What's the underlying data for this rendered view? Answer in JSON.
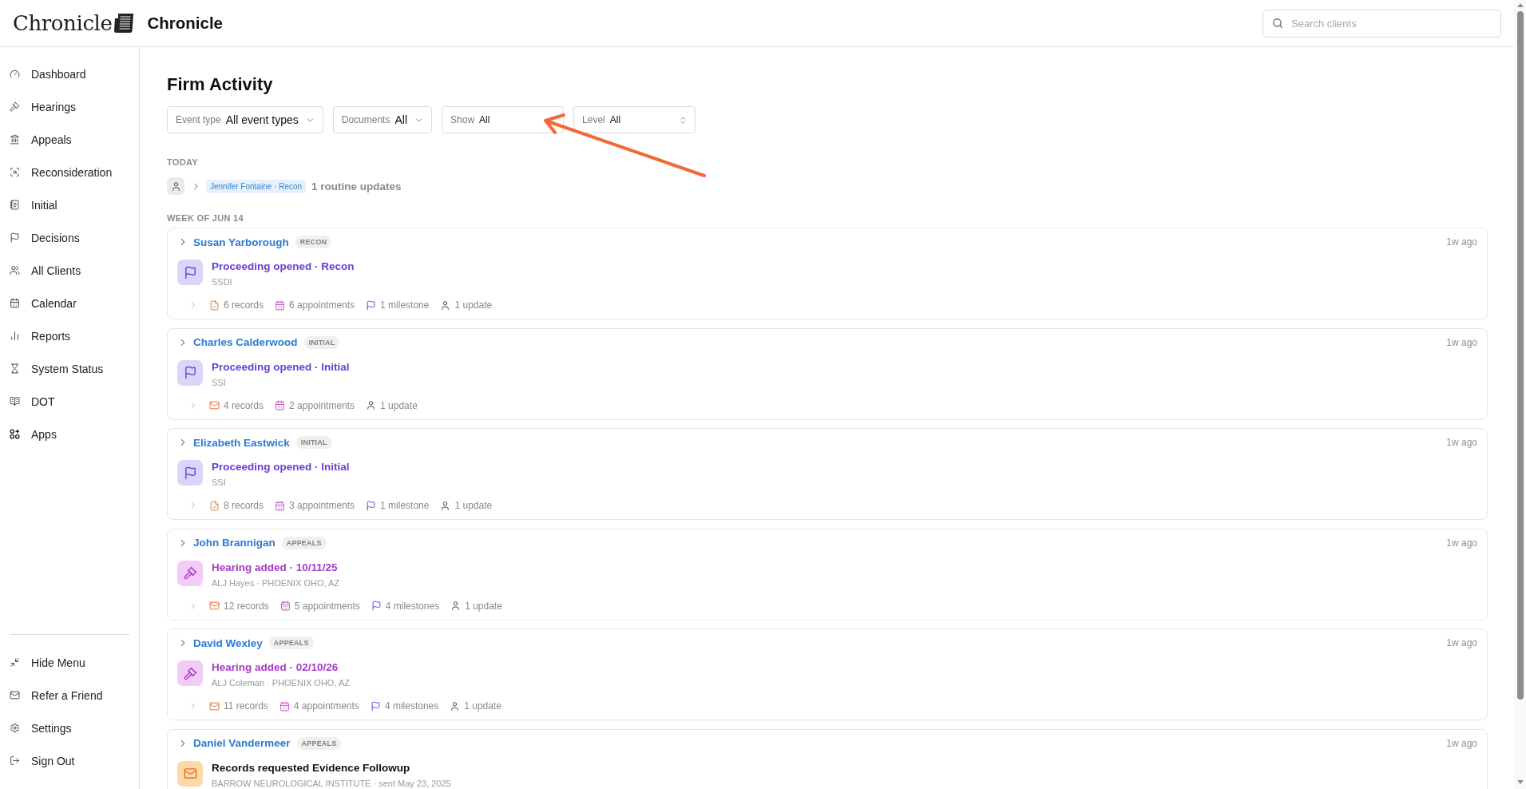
{
  "header": {
    "logo": "Chronicle",
    "title": "Chronicle",
    "search": {
      "placeholder": "Search clients"
    }
  },
  "sidebar": {
    "items": [
      {
        "label": "Dashboard",
        "selected": false
      },
      {
        "label": "Hearings",
        "selected": false
      },
      {
        "label": "Appeals",
        "selected": false
      },
      {
        "label": "Reconsideration",
        "selected": false
      },
      {
        "label": "Initial",
        "selected": false
      },
      {
        "label": "Decisions",
        "selected": false
      },
      {
        "label": "All Clients",
        "selected": false
      },
      {
        "label": "Calendar",
        "selected": false
      },
      {
        "label": "Reports",
        "selected": false
      },
      {
        "label": "System Status",
        "selected": false
      },
      {
        "label": "DOT",
        "selected": false
      },
      {
        "label": "Apps",
        "selected": false
      }
    ],
    "footer_items": [
      {
        "label": "Hide Menu"
      },
      {
        "label": "Refer a Friend"
      },
      {
        "label": "Settings"
      },
      {
        "label": "Sign Out"
      }
    ]
  },
  "page": {
    "title": "Firm Activity",
    "filters": [
      {
        "kind": "dropdown",
        "label": "Event type",
        "value": "All event types"
      },
      {
        "kind": "dropdown",
        "label": "Documents",
        "value": "All"
      },
      {
        "kind": "select",
        "label": "Show",
        "value": "All"
      },
      {
        "kind": "select",
        "label": "Level",
        "value": "All"
      }
    ],
    "sections": [
      {
        "heading": "TODAY",
        "routine": [
          {
            "tag": "Jennifer Fontaine · Recon",
            "summary": "1 routine updates"
          }
        ]
      },
      {
        "heading": "WEEK OF JUN 14",
        "cards": [
          {
            "client": "Susan Yarborough",
            "badge": "RECON",
            "time": "1w ago",
            "event": {
              "kind": "proceeding",
              "title": "Proceeding opened · Recon",
              "detail": "SSDI"
            },
            "stats": [
              {
                "kind": "document",
                "label": "6 records"
              },
              {
                "kind": "calendar",
                "label": "6 appointments"
              },
              {
                "kind": "flag",
                "label": "1 milestone"
              },
              {
                "kind": "person",
                "label": "1 update"
              }
            ]
          },
          {
            "client": "Charles Calderwood",
            "badge": "INITIAL",
            "time": "1w ago",
            "event": {
              "kind": "proceeding",
              "title": "Proceeding opened · Initial",
              "detail": "SSI"
            },
            "stats": [
              {
                "kind": "mail",
                "label": "4 records"
              },
              {
                "kind": "calendar",
                "label": "2 appointments"
              },
              {
                "kind": "person",
                "label": "1 update"
              }
            ]
          },
          {
            "client": "Elizabeth Eastwick",
            "badge": "INITIAL",
            "time": "1w ago",
            "event": {
              "kind": "proceeding",
              "title": "Proceeding opened · Initial",
              "detail": "SSI"
            },
            "stats": [
              {
                "kind": "document",
                "label": "8 records"
              },
              {
                "kind": "calendar",
                "label": "3 appointments"
              },
              {
                "kind": "flag",
                "label": "1 milestone"
              },
              {
                "kind": "person",
                "label": "1 update"
              }
            ]
          },
          {
            "client": "John Brannigan",
            "badge": "APPEALS",
            "time": "1w ago",
            "event": {
              "kind": "hearing",
              "title": "Hearing added · 10/11/25",
              "detail": "ALJ Hayes · PHOENIX OHO, AZ"
            },
            "stats": [
              {
                "kind": "mail",
                "label": "12 records"
              },
              {
                "kind": "calendar",
                "label": "5 appointments"
              },
              {
                "kind": "flag",
                "label": "4 milestones"
              },
              {
                "kind": "person",
                "label": "1 update"
              }
            ]
          },
          {
            "client": "David Wexley",
            "badge": "APPEALS",
            "time": "1w ago",
            "event": {
              "kind": "hearing",
              "title": "Hearing added · 02/10/26",
              "detail": "ALJ Coleman · PHOENIX OHO, AZ"
            },
            "stats": [
              {
                "kind": "mail",
                "label": "11 records"
              },
              {
                "kind": "calendar",
                "label": "4 appointments"
              },
              {
                "kind": "flag",
                "label": "4 milestones"
              },
              {
                "kind": "person",
                "label": "1 update"
              }
            ]
          },
          {
            "client": "Daniel Vandermeer",
            "badge": "APPEALS",
            "time": "1w ago",
            "event": {
              "kind": "records",
              "title": "Records requested Evidence Followup",
              "detail": "BARROW NEUROLOGICAL INSTITUTE · sent May 23, 2025"
            }
          }
        ]
      }
    ]
  }
}
